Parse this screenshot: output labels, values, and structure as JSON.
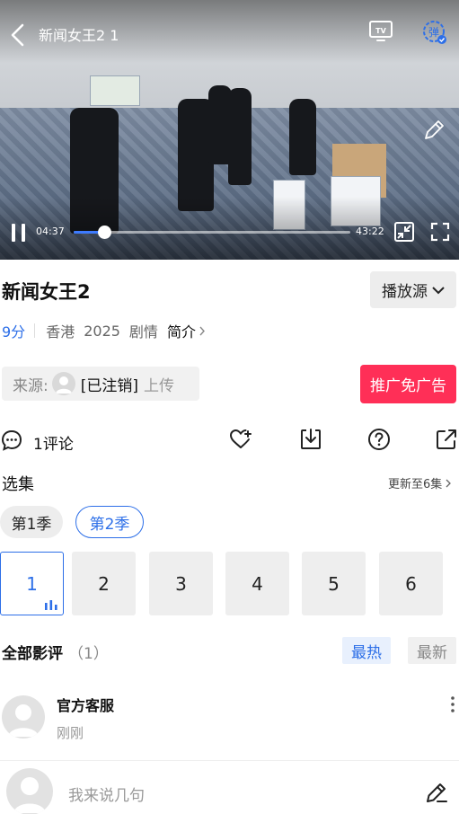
{
  "player": {
    "title": "新闻女王2 1",
    "current_time": "04:37",
    "total_time": "43:22",
    "progress": 0.11,
    "icons": [
      "back-icon",
      "tv-cast-icon",
      "danmu-icon",
      "pencil-icon",
      "pause-icon",
      "pip-icon",
      "fullscreen-icon"
    ]
  },
  "show": {
    "title": "新闻女王2",
    "source_label": "播放源",
    "score": "9分",
    "region": "香港",
    "year": "2025",
    "genre": "剧情",
    "intro_label": "简介"
  },
  "upload": {
    "source_prefix": "来源:",
    "uploader": "[已注销]",
    "upload_word": "上传",
    "promo_label": "推广免广告"
  },
  "actions": {
    "comment_label": "1评论",
    "icons": [
      "comment-icon",
      "heart-plus-icon",
      "download-icon",
      "help-icon",
      "share-icon"
    ]
  },
  "episodes": {
    "section_label": "选集",
    "update_info": "更新至6集",
    "seasons": [
      "第1季",
      "第2季"
    ],
    "active_season": 1,
    "items": [
      "1",
      "2",
      "3",
      "4",
      "5",
      "6"
    ],
    "active_episode": 0
  },
  "reviews": {
    "title": "全部影评",
    "count": "（1）",
    "sort_hot": "最热",
    "sort_new": "最新",
    "items": [
      {
        "author": "官方客服",
        "time": "刚刚"
      }
    ]
  },
  "composer": {
    "placeholder": "我来说几句"
  },
  "colors": {
    "accent": "#2d6fe8",
    "promo": "#ff2f57",
    "progress_fill": "#3d7bff"
  }
}
